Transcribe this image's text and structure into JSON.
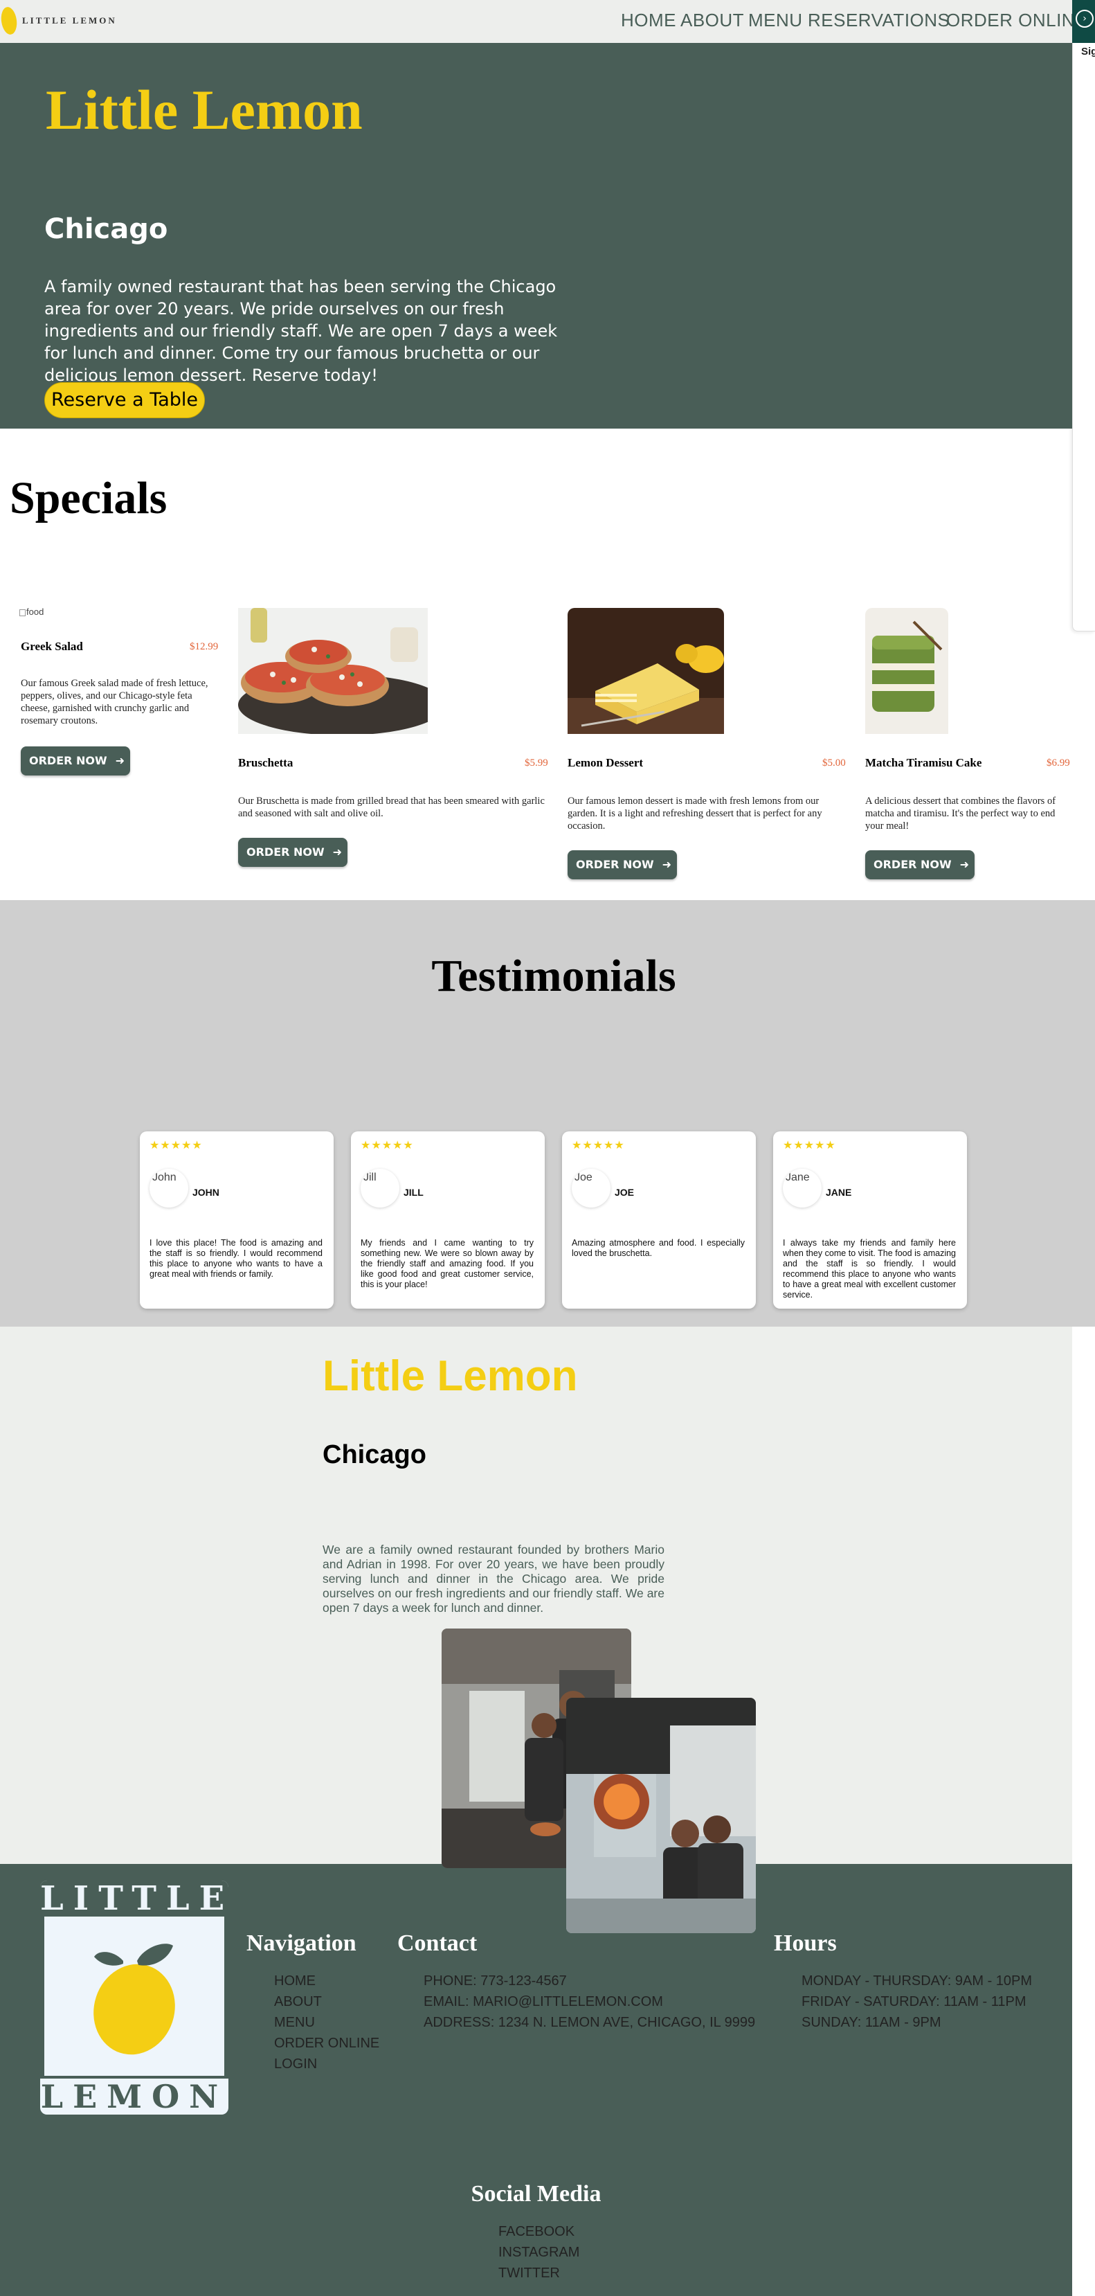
{
  "nav": {
    "brand": "LITTLE LEMON",
    "links": [
      "HOME",
      "ABOUT",
      "MENU",
      "RESERVATIONS",
      "ORDER ONLINE"
    ],
    "side_label": "Sig"
  },
  "hero": {
    "title": "Little Lemon",
    "subtitle": "Chicago",
    "description": "A family owned restaurant that has been serving the Chicago area for over 20 years. We pride ourselves on our fresh ingredients and our friendly staff. We are open 7 days a week for lunch and dinner. Come try our famous bruchetta or our delicious lemon dessert. Reserve today!",
    "button": "Reserve a Table"
  },
  "specials": {
    "title": "Specials",
    "broken_image_alt": "food",
    "order_label": "ORDER NOW",
    "items": [
      {
        "name": "Greek Salad",
        "price": "$12.99",
        "description": "Our famous Greek salad made of fresh lettuce, peppers, olives, and our Chicago-style feta cheese, garnished with crunchy garlic and rosemary croutons."
      },
      {
        "name": "Bruschetta",
        "price": "$5.99",
        "description": "Our Bruschetta is made from grilled bread that has been smeared with garlic and seasoned with salt and olive oil."
      },
      {
        "name": "Lemon Dessert",
        "price": "$5.00",
        "description": "Our famous lemon dessert is made with fresh lemons from our garden. It is a light and refreshing dessert that is perfect for any occasion."
      },
      {
        "name": "Matcha Tiramisu Cake",
        "price": "$6.99",
        "description": "A delicious dessert that combines the flavors of matcha and tiramisu. It's the perfect way to end your meal!"
      }
    ]
  },
  "testimonials": {
    "title": "Testimonials",
    "stars": "★★★★★",
    "items": [
      {
        "alt": "John",
        "name": "JOHN",
        "text": "I love this place! The food is amazing and the staff is so friendly. I would recommend this place to anyone who wants to have a great meal with friends or family."
      },
      {
        "alt": "Jill",
        "name": "JILL",
        "text": "My friends and I came wanting to try something new. We were so blown away by the friendly staff and amazing food. If you like good food and great customer service, this is your place!"
      },
      {
        "alt": "Joe",
        "name": "JOE",
        "text": "Amazing atmosphere and food. I especially loved the bruschetta."
      },
      {
        "alt": "Jane",
        "name": "JANE",
        "text": "I always take my friends and family here when they come to visit. The food is amazing and the staff is so friendly. I would recommend this place to anyone who wants to have a great meal with excellent customer service."
      }
    ]
  },
  "about": {
    "title": "Little Lemon",
    "subtitle": "Chicago",
    "description": "We are a family owned restaurant founded by brothers Mario and Adrian in 1998. For over 20 years, we have been proudly serving lunch and dinner in the Chicago area. We pride ourselves on our fresh ingredients and our friendly staff. We are open 7 days a week for lunch and dinner."
  },
  "footer": {
    "logo_top": "LITTLE",
    "logo_bottom": "LEMON",
    "navigation": {
      "title": "Navigation",
      "links": [
        "HOME",
        "ABOUT",
        "MENU",
        "ORDER ONLINE",
        "LOGIN"
      ]
    },
    "contact": {
      "title": "Contact",
      "lines": [
        "PHONE: 773-123-4567",
        "EMAIL: MARIO@LITTLELEMON.COM",
        "ADDRESS: 1234 N. LEMON AVE, CHICAGO, IL 9999"
      ]
    },
    "hours": {
      "title": "Hours",
      "lines": [
        "MONDAY - THURSDAY: 9AM - 10PM",
        "FRIDAY - SATURDAY: 11AM - 11PM",
        "SUNDAY: 11AM - 9PM"
      ]
    },
    "social": {
      "title": "Social Media",
      "links": [
        "FACEBOOK",
        "INSTAGRAM",
        "TWITTER"
      ]
    }
  },
  "colors": {
    "primary_green": "#495e57",
    "primary_yellow": "#f4ce14",
    "price_orange": "#e2653a",
    "nav_bg": "#edeeec",
    "testimonials_bg": "#cfcfcf"
  }
}
